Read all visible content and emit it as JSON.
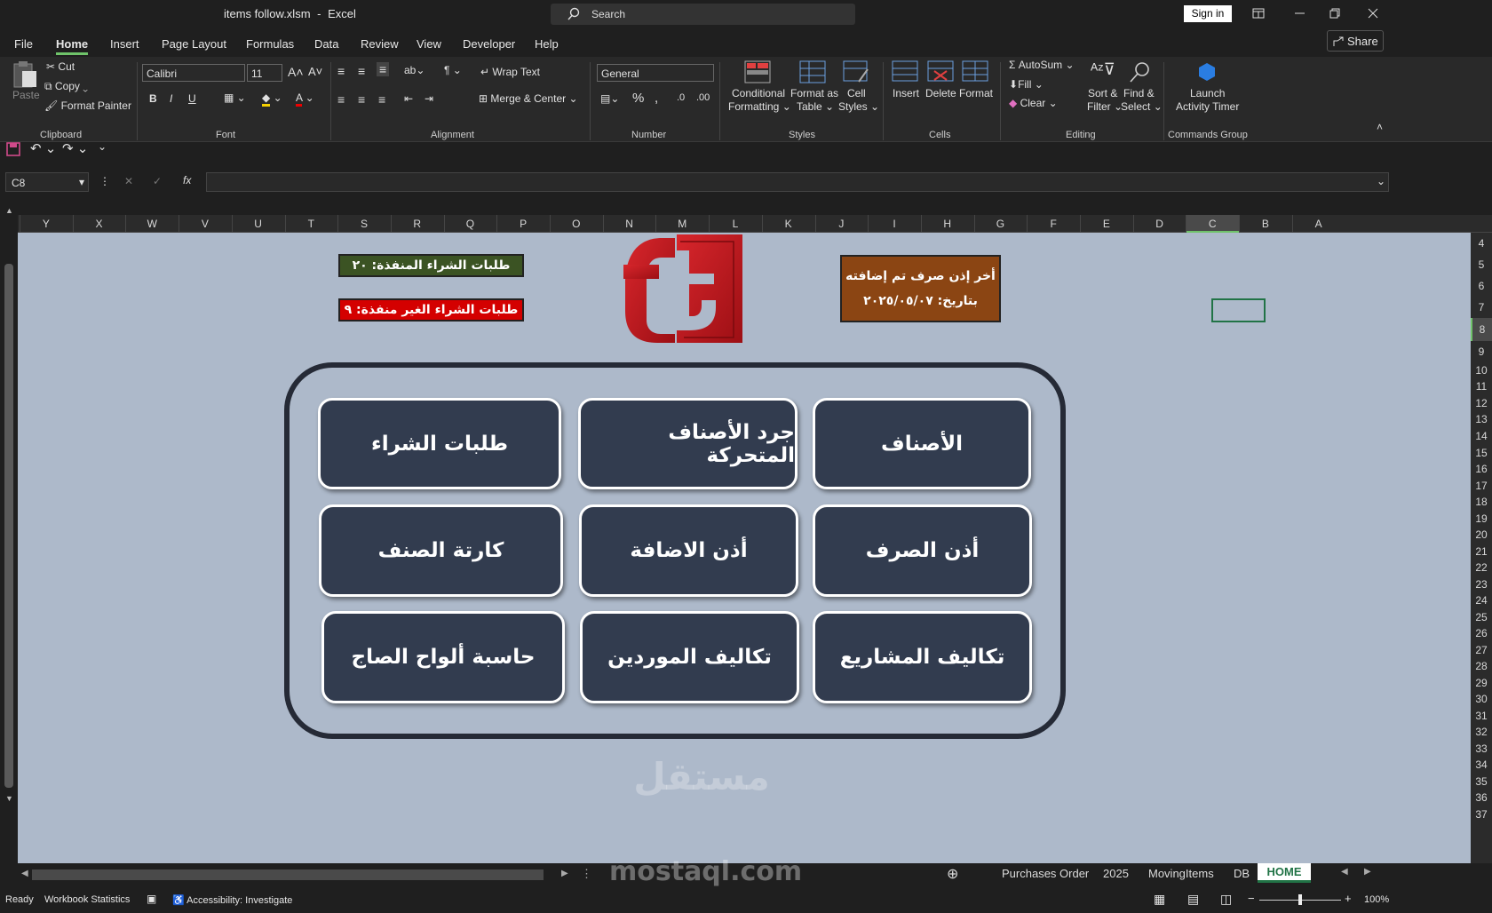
{
  "window": {
    "file_title": "items follow.xlsm",
    "app_name": "Excel",
    "separator": "-",
    "search_placeholder": "Search",
    "sign_in": "Sign in"
  },
  "menu": [
    "File",
    "Home",
    "Insert",
    "Page Layout",
    "Formulas",
    "Data",
    "Review",
    "View",
    "Developer",
    "Help"
  ],
  "share_label": "Share",
  "ribbon": {
    "clipboard": {
      "paste": "Paste",
      "cut": "Cut",
      "copy": "Copy",
      "format_painter": "Format Painter",
      "group": "Clipboard"
    },
    "font": {
      "name": "Calibri",
      "size": "11",
      "group": "Font",
      "bold": "B",
      "italic": "I",
      "underline": "U"
    },
    "alignment": {
      "wrap_text": "Wrap Text",
      "merge_center": "Merge & Center",
      "group": "Alignment"
    },
    "number": {
      "format": "General",
      "group": "Number"
    },
    "styles": {
      "conditional": "Conditional",
      "conditional2": "Formatting",
      "format_as": "Format as",
      "format_as2": "Table",
      "cell": "Cell",
      "cell2": "Styles",
      "group": "Styles"
    },
    "cells": {
      "insert": "Insert",
      "delete": "Delete",
      "format": "Format",
      "group": "Cells"
    },
    "editing": {
      "autosum": "AutoSum",
      "fill": "Fill",
      "clear": "Clear",
      "sort": "Sort &",
      "sort2": "Filter",
      "find": "Find &",
      "find2": "Select",
      "group": "Editing"
    },
    "commands": {
      "launch": "Launch",
      "launch2": "Activity Timer",
      "group": "Commands Group"
    }
  },
  "formula_bar": {
    "name_box": "C8",
    "fx": "fx",
    "value": ""
  },
  "columns": [
    "Y",
    "X",
    "W",
    "V",
    "U",
    "T",
    "S",
    "R",
    "Q",
    "P",
    "O",
    "N",
    "M",
    "L",
    "K",
    "J",
    "I",
    "H",
    "G",
    "F",
    "E",
    "D",
    "C",
    "B",
    "A"
  ],
  "rows": [
    "4",
    "5",
    "6",
    "7",
    "8",
    "9",
    "10",
    "11",
    "12",
    "13",
    "14",
    "15",
    "16",
    "17",
    "18",
    "19",
    "20",
    "21",
    "22",
    "23",
    "24",
    "25",
    "26",
    "27",
    "28",
    "29",
    "30",
    "31",
    "32",
    "33",
    "34",
    "35",
    "36",
    "37"
  ],
  "dashboard": {
    "executed_label": "طلبات الشراء المنفذة: ٢٠",
    "pending_label": "طلبات الشراء الغير منفذة: ٩",
    "last_issue_line1": "أخر إذن صرف تم إضافته",
    "last_issue_line2": "بتاريخ: ٢٠٢٥/٠٥/٠٧",
    "buttons": [
      "الأصناف",
      "جرد الأصناف المتحركة",
      "طلبات الشراء",
      "أذن الصرف",
      "أذن الاضافة",
      "كارتة الصنف",
      "تكاليف المشاريع",
      "تكاليف الموردين",
      "حاسبة ألواح الصاج"
    ],
    "watermark_ar": "مستقل",
    "watermark_en": "mostaql.com",
    "colors": {
      "sheet_bg": "#adb9ca",
      "button_bg": "#323c4f",
      "green_badge": "#3b5323",
      "red_badge": "#d40000",
      "brown_badge": "#8b4513",
      "logo_red": "#c0151b"
    }
  },
  "sheet_tabs": [
    "Purchases Order",
    "2025",
    "MovingItems",
    "DB",
    "HOME"
  ],
  "status": {
    "ready": "Ready",
    "workbook_stats": "Workbook Statistics",
    "accessibility": "Accessibility: Investigate",
    "zoom": "100%"
  }
}
